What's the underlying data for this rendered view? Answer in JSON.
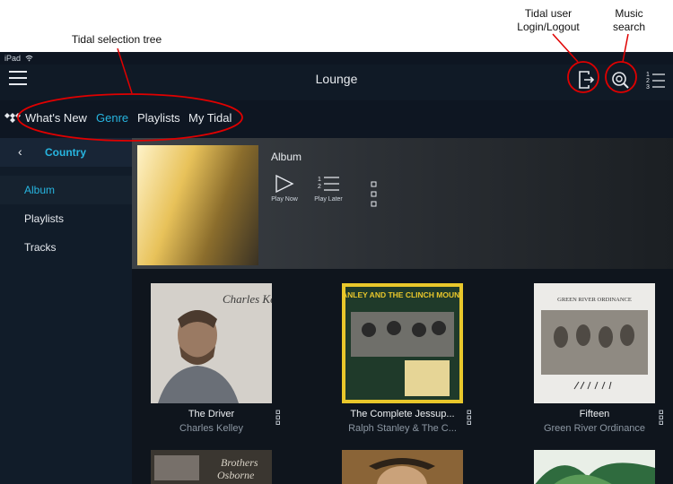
{
  "annotations": {
    "tree": "Tidal selection tree",
    "login": "Tidal user Login/Logout",
    "search": "Music search"
  },
  "status": {
    "device": "iPad"
  },
  "navbar": {
    "title": "Lounge"
  },
  "icons": {
    "hamburger": "hamburger-icon",
    "login": "login-logout-icon",
    "search": "search-icon",
    "queue": "numbered-list-icon",
    "tidal": "tidal-logo-icon",
    "play": "play-icon",
    "later": "play-later-icon",
    "more": "more-icon"
  },
  "tabs": [
    {
      "label": "What's New"
    },
    {
      "label": "Genre",
      "active": true
    },
    {
      "label": "Playlists"
    },
    {
      "label": "My Tidal"
    }
  ],
  "sidebar": {
    "back": "‹",
    "title": "Country",
    "items": [
      {
        "label": "Album",
        "active": true
      },
      {
        "label": "Playlists"
      },
      {
        "label": "Tracks"
      }
    ]
  },
  "hero": {
    "title": "Album",
    "play_now": "Play Now",
    "play_later": "Play Later"
  },
  "albums": [
    {
      "title": "The Driver",
      "artist": "Charles Kelley",
      "cover_text": "Charles Kelley"
    },
    {
      "title": "The Complete Jessup...",
      "artist": "Ralph Stanley & The C...",
      "cover_text": "RALPH STANLEY AND THE CLINCH MOUNTAIN BOYS"
    },
    {
      "title": "Fifteen",
      "artist": "Green River Ordinance",
      "cover_text": "GREEN RIVER ORDINANCE"
    }
  ],
  "colors": {
    "accent": "#27b5e0",
    "background": "#0e1622",
    "annotation": "#e00000"
  }
}
